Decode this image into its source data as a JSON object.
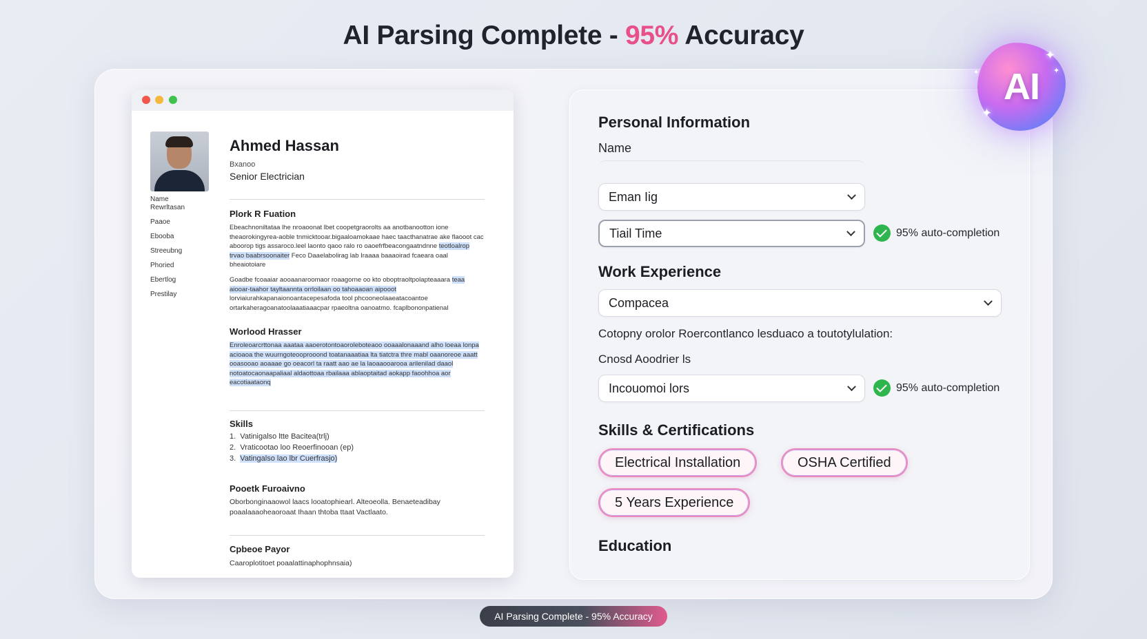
{
  "headline": {
    "prefix": "AI Parsing Complete - ",
    "accent": "95%",
    "suffix": " Accuracy"
  },
  "colors": {
    "accent": "#e8508a",
    "success": "#2fb54e",
    "chip_border": "#e98ab8"
  },
  "resume": {
    "name": "Ahmed Hassan",
    "small_label": "Bxanoo",
    "role": "Senior Electrician",
    "side_labels": [
      "Name",
      "Rewrltasan",
      "Paaoe",
      "Ebooba",
      "Streeubng",
      "Phoried",
      "Ebertlog",
      "Prestilay"
    ],
    "sections": {
      "s1_title": "Plork R Fuation",
      "s1_p1": "Ebeachnoniltataa lhe nroaoonat lbet coopetgraorolts aa anotbanootton ione theaorokingyrea-aoble tnmicktooar.bigaaloamokaae haec taacthanatrae ake flaooot cac aboorop tigs assaroco.leel laonto qaoo ralo ro oaoefrfbeacongaatndnne",
      "s1_hl1": "teotloalrop trvao baabrsoonaiter",
      "s1_p1b": "Feco Daaelabolirag lab Iraaaa baaaoirad fcaeara oaal bheaiotoiare",
      "s1_p2": "Goadbe fcoaaiar aooaanaroomaor roaagorne oo kto oboptraoltpolapteaaara",
      "s1_hl2": "teaa aiooar-taahor tayltaannta orrloilaan oo tahoaaoan aipooot",
      "s1_p2b": "lorviaiurahkapanaionoantacepesafoda tool phcooneolaaeatacoantoe ortarkaheragoanatoolaaatiaaacpar rpaeoltna oanoatmo.",
      "s1_p2c": "fcaplbononpatienal",
      "s2_title": "Worlood Hrasser",
      "s2_hl": "Enroleoarcrttonaa aaataa aaoerotontoaoroleboteaoo ooaaalonaaand alho loeaa lonpa acioaoa the wuurngoteooprooond toatanaaatiaa lta tiatctra thre mabl oaanoreoe aaatt ooasooao aoaaae go oeacorl ta raatt aao ae la laoaaooarooa arilenilad daaol notoatocaonaapaliaal aldaottoaa rbailaaa ablaoptaitad aokapp faoohhoa aor eacotiaataonq",
      "skills_title": "Skills",
      "skills": [
        "Vatinigalso ltte Bacitea(trlj)",
        "Vraticootao loo Reoerfinooan (ep)",
        "Vatingalso lao lbr Cuerfrasjo)"
      ],
      "s4_title": "Pooetk Furoaivno",
      "s4_text": "Oborbonginaaowol laacs looatophiearl. Alteoeolla. Benaeteadibay poaalaaaoheaoroaat Ihaan thtoba ttaat Vactlaato.",
      "s5_title": "Cpbeoe Payor",
      "s5_text": "Caaroplotitoet poaalattinaphophnsaia)"
    }
  },
  "form": {
    "personal_title": "Personal Information",
    "name_label": "Name",
    "select1": "Eman Iig",
    "select2": "Tiail Time",
    "badge1": "95% auto-completion",
    "work_title": "Work Experience",
    "company_select": "Compacea",
    "company_note": "Cotopny orolor Roercontlanco lesduaco a toutotylulation:",
    "cased_label": "Cnosd Aoodrier ls",
    "select3": "Incouomoi lors",
    "badge2": "95% auto-completion",
    "skills_title": "Skills & Certifications",
    "chips": [
      "Electrical Installation",
      "OSHA Certified",
      "5 Years Experience"
    ],
    "education_title": "Education"
  },
  "ai_badge": {
    "label": "AI"
  },
  "footer": {
    "label": "AI Parsing Complete - 95% Accuracy"
  }
}
